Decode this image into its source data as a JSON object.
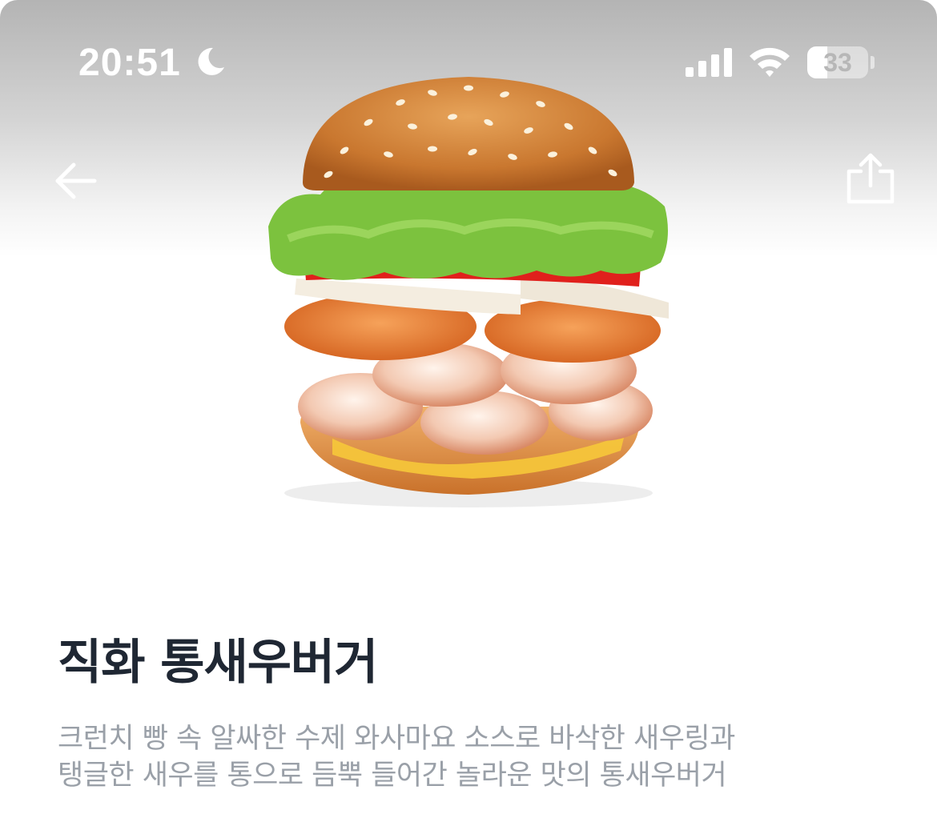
{
  "status_bar": {
    "time": "20:51",
    "battery_level": "33",
    "battery_fraction": 0.33,
    "icons": [
      "moon-icon",
      "signal-icon",
      "wifi-icon",
      "battery-icon"
    ]
  },
  "nav": {
    "back_icon": "arrow-left-icon",
    "share_icon": "share-icon"
  },
  "product": {
    "image": "burger-photo",
    "title": "직화 통새우버거",
    "description_line1": "크런치 빵 속 알싸한 수제 와사마요 소스로 바삭한 새우링과",
    "description_line2": "탱글한 새우를 통으로 듬뿍 들어간 놀라운 맛의 통새우버거"
  },
  "colors": {
    "title": "#1f2733",
    "description": "#9aa0a8",
    "header_gradient_top": "#b4b4b4",
    "background": "#ffffff"
  }
}
